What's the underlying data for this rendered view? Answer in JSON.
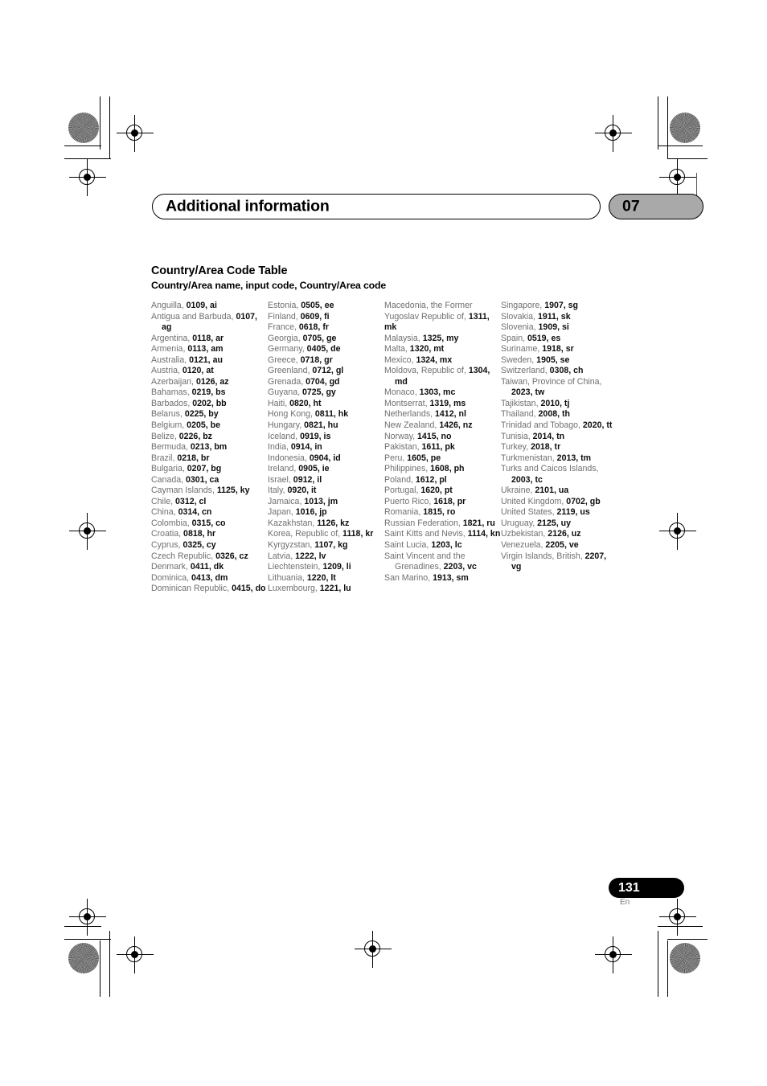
{
  "header": {
    "chapter_title": "Additional information",
    "chapter_number": "07"
  },
  "section": {
    "title": "Country/Area Code Table",
    "subtitle": "Country/Area name, input code, Country/Area code"
  },
  "footer": {
    "page_number": "131",
    "language": "En"
  },
  "colors": {
    "badge_gray": "#a9a9a9",
    "name_gray": "#6f6f6f",
    "code_black": "#0d0d0d",
    "page_badge": "#000000"
  },
  "columns": [
    {
      "entries": [
        {
          "name": "Anguilla,",
          "code": "0109, ai"
        },
        {
          "name": "Antigua and Barbuda,",
          "code": "0107, ag",
          "wrapped": true
        },
        {
          "name": "Argentina,",
          "code": "0118, ar"
        },
        {
          "name": "Armenia,",
          "code": "0113, am"
        },
        {
          "name": "Australia,",
          "code": "0121, au"
        },
        {
          "name": "Austria,",
          "code": "0120, at"
        },
        {
          "name": "Azerbaijan,",
          "code": "0126, az"
        },
        {
          "name": "Bahamas,",
          "code": "0219, bs"
        },
        {
          "name": "Barbados,",
          "code": "0202, bb"
        },
        {
          "name": "Belarus,",
          "code": "0225, by"
        },
        {
          "name": "Belgium,",
          "code": "0205, be"
        },
        {
          "name": "Belize,",
          "code": "0226, bz"
        },
        {
          "name": "Bermuda,",
          "code": "0213, bm"
        },
        {
          "name": "Brazil,",
          "code": "0218, br"
        },
        {
          "name": "Bulgaria,",
          "code": "0207, bg"
        },
        {
          "name": "Canada,",
          "code": "0301, ca"
        },
        {
          "name": "Cayman Islands,",
          "code": "1125, ky"
        },
        {
          "name": "Chile,",
          "code": "0312, cl"
        },
        {
          "name": "China,",
          "code": "0314, cn"
        },
        {
          "name": "Colombia,",
          "code": "0315, co"
        },
        {
          "name": "Croatia,",
          "code": "0818, hr"
        },
        {
          "name": "Cyprus,",
          "code": "0325, cy"
        },
        {
          "name": "Czech Republic,",
          "code": "0326, cz"
        },
        {
          "name": "Denmark,",
          "code": "0411, dk"
        },
        {
          "name": "Dominica,",
          "code": "0413, dm"
        },
        {
          "name": "Dominican Republic,",
          "code": "0415, do",
          "wrapped": true
        }
      ]
    },
    {
      "entries": [
        {
          "name": "Estonia,",
          "code": "0505, ee"
        },
        {
          "name": "Finland,",
          "code": "0609, fi"
        },
        {
          "name": "France,",
          "code": "0618, fr"
        },
        {
          "name": "Georgia,",
          "code": "0705, ge"
        },
        {
          "name": "Germany,",
          "code": "0405, de"
        },
        {
          "name": "Greece,",
          "code": "0718, gr"
        },
        {
          "name": "Greenland,",
          "code": "0712, gl"
        },
        {
          "name": "Grenada,",
          "code": "0704, gd"
        },
        {
          "name": "Guyana,",
          "code": "0725, gy"
        },
        {
          "name": "Haiti,",
          "code": "0820, ht"
        },
        {
          "name": "Hong Kong,",
          "code": "0811, hk"
        },
        {
          "name": "Hungary,",
          "code": "0821, hu"
        },
        {
          "name": "Iceland,",
          "code": "0919, is"
        },
        {
          "name": "India,",
          "code": "0914, in"
        },
        {
          "name": "Indonesia,",
          "code": "0904, id"
        },
        {
          "name": "Ireland,",
          "code": "0905, ie"
        },
        {
          "name": "Israel,",
          "code": "0912, il"
        },
        {
          "name": "Italy,",
          "code": "0920, it"
        },
        {
          "name": "Jamaica,",
          "code": "1013, jm"
        },
        {
          "name": "Japan,",
          "code": "1016, jp"
        },
        {
          "name": "Kazakhstan,",
          "code": "1126, kz"
        },
        {
          "name": "Korea, Republic of,",
          "code": "1118, kr",
          "split_code": [
            "1118,",
            "kr"
          ]
        },
        {
          "name": "Kyrgyzstan,",
          "code": "1107, kg"
        },
        {
          "name": "Latvia,",
          "code": "1222, lv"
        },
        {
          "name": "Liechtenstein,",
          "code": "1209, li"
        },
        {
          "name": "Lithuania,",
          "code": "1220, lt"
        },
        {
          "name": "Luxembourg,",
          "code": "1221, lu"
        }
      ]
    },
    {
      "entries": [
        {
          "name": "Macedonia, the Former Yugoslav Republic of,",
          "code": "1311, mk",
          "split_code": [
            "1311,",
            "mk"
          ]
        },
        {
          "name": "Malaysia,",
          "code": "1325, my"
        },
        {
          "name": "Malta,",
          "code": "1320, mt"
        },
        {
          "name": "Mexico,",
          "code": "1324, mx"
        },
        {
          "name": "Moldova, Republic of,",
          "code": "1304, md",
          "wrapped": true
        },
        {
          "name": "Monaco,",
          "code": "1303, mc"
        },
        {
          "name": "Montserrat,",
          "code": "1319, ms"
        },
        {
          "name": "Netherlands,",
          "code": "1412, nl"
        },
        {
          "name": "New Zealand,",
          "code": "1426, nz"
        },
        {
          "name": "Norway,",
          "code": "1415, no"
        },
        {
          "name": "Pakistan,",
          "code": "1611, pk"
        },
        {
          "name": "Peru,",
          "code": "1605, pe"
        },
        {
          "name": "Philippines,",
          "code": "1608, ph"
        },
        {
          "name": "Poland,",
          "code": "1612, pl"
        },
        {
          "name": "Portugal,",
          "code": "1620, pt"
        },
        {
          "name": "Puerto Rico,",
          "code": "1618, pr"
        },
        {
          "name": "Romania,",
          "code": "1815, ro"
        },
        {
          "name": "Russian Federation,",
          "code": "1821, ru",
          "split_code": [
            "1821,",
            "ru"
          ]
        },
        {
          "name": "Saint Kitts and Nevis,",
          "code": "1114, kn",
          "wrapped": true
        },
        {
          "name": "Saint Lucia,",
          "code": "1203, lc"
        },
        {
          "name": "Saint Vincent and the Grenadines,",
          "code": "2203, vc",
          "wrapped": true
        },
        {
          "name": "San Marino,",
          "code": "1913, sm"
        }
      ]
    },
    {
      "entries": [
        {
          "name": "Singapore,",
          "code": "1907, sg"
        },
        {
          "name": "Slovakia,",
          "code": "1911, sk"
        },
        {
          "name": "Slovenia,",
          "code": "1909, si"
        },
        {
          "name": "Spain,",
          "code": "0519, es"
        },
        {
          "name": "Suriname,",
          "code": "1918, sr"
        },
        {
          "name": "Sweden,",
          "code": "1905, se"
        },
        {
          "name": "Switzerland,",
          "code": "0308, ch"
        },
        {
          "name": "Taiwan, Province of China,",
          "code": "2023, tw",
          "wrapped": true
        },
        {
          "name": "Tajikistan,",
          "code": "2010, tj"
        },
        {
          "name": "Thailand,",
          "code": "2008, th"
        },
        {
          "name": "Trinidad and Tobago,",
          "code": "2020, tt",
          "wrapped": true
        },
        {
          "name": "Tunisia,",
          "code": "2014, tn"
        },
        {
          "name": "Turkey,",
          "code": "2018, tr"
        },
        {
          "name": "Turkmenistan,",
          "code": "2013, tm"
        },
        {
          "name": "Turks and Caicos Islands,",
          "code": "2003, tc",
          "wrapped": true
        },
        {
          "name": "Ukraine,",
          "code": "2101, ua"
        },
        {
          "name": "United Kingdom,",
          "code": "0702, gb"
        },
        {
          "name": "United States,",
          "code": "2119, us"
        },
        {
          "name": "Uruguay,",
          "code": "2125, uy"
        },
        {
          "name": "Uzbekistan,",
          "code": "2126, uz"
        },
        {
          "name": "Venezuela,",
          "code": "2205, ve"
        },
        {
          "name": "Virgin Islands, British,",
          "code": "2207, vg",
          "wrapped": true
        }
      ]
    }
  ]
}
